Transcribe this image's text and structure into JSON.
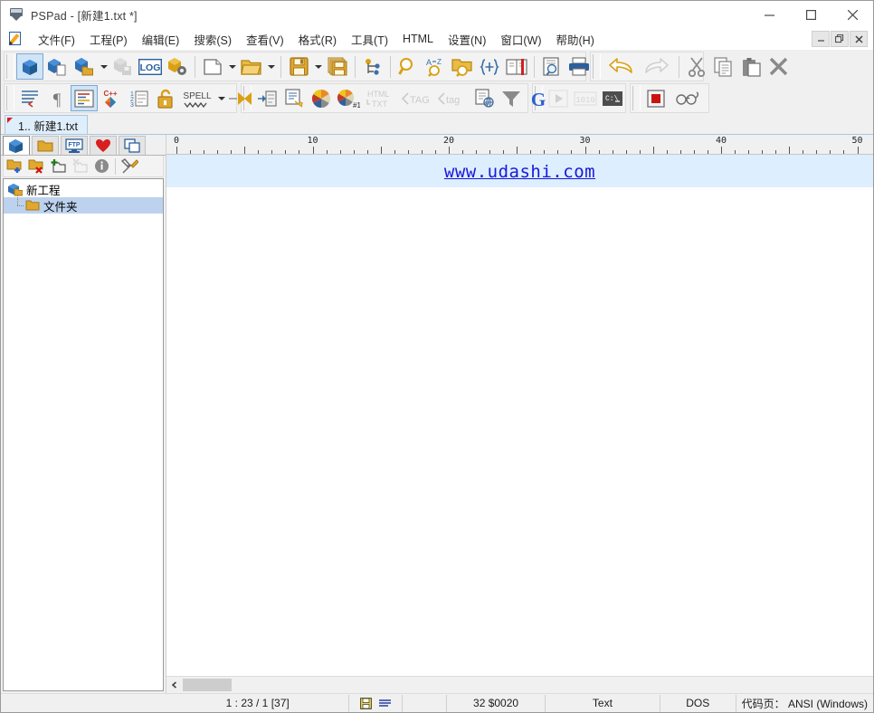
{
  "window": {
    "title": "PSPad - [新建1.txt *]",
    "app_icon": "pspad-monitor-icon",
    "controls": {
      "minimize": "minimize-icon",
      "maximize": "maximize-icon",
      "close": "close-icon"
    },
    "mdi_controls": {
      "minimize": "mdi-minimize-icon",
      "restore": "mdi-restore-icon",
      "close": "mdi-close-icon"
    }
  },
  "menubar": {
    "app_icon": "document-pencil-icon",
    "items": [
      {
        "text": "文件(F)",
        "accel": "F"
      },
      {
        "text": "工程(P)",
        "accel": "P"
      },
      {
        "text": "编辑(E)",
        "accel": "E"
      },
      {
        "text": "搜索(S)",
        "accel": "S"
      },
      {
        "text": "查看(V)",
        "accel": "V"
      },
      {
        "text": "格式(R)",
        "accel": "R"
      },
      {
        "text": "工具(T)",
        "accel": "T"
      },
      {
        "text": "HTML",
        "accel": "M"
      },
      {
        "text": "设置(N)",
        "accel": "N"
      },
      {
        "text": "窗口(W)",
        "accel": "W"
      },
      {
        "text": "帮助(H)",
        "accel": "H"
      }
    ]
  },
  "toolbar_row1": [
    {
      "name": "project-new-button",
      "icon": "blue-cube-icon",
      "state": "active"
    },
    {
      "name": "project-open-button",
      "icon": "cube-with-page-icon",
      "state": "normal"
    },
    {
      "name": "project-open-folder-button",
      "icon": "cube-with-folder-icon",
      "state": "normal"
    },
    {
      "name": "project-recent-dropdown",
      "icon": "chevron-down-icon",
      "state": "normal"
    },
    {
      "name": "project-save-button",
      "icon": "cube-save-icon",
      "state": "disabled"
    },
    {
      "name": "project-log-button",
      "icon": "log-icon",
      "state": "normal"
    },
    {
      "name": "project-settings-button",
      "icon": "cube-gear-icon",
      "state": "normal"
    },
    {
      "name": "file-new-button",
      "icon": "new-page-icon",
      "state": "normal"
    },
    {
      "name": "file-new-dropdown",
      "icon": "chevron-down-icon",
      "state": "normal"
    },
    {
      "name": "file-open-button",
      "icon": "open-folder-icon",
      "state": "normal"
    },
    {
      "name": "file-open-dropdown",
      "icon": "chevron-down-icon",
      "state": "normal"
    },
    {
      "name": "file-save-button",
      "icon": "floppy-save-icon",
      "state": "normal"
    },
    {
      "name": "file-save-dropdown",
      "icon": "chevron-down-icon",
      "state": "normal"
    },
    {
      "name": "file-save-all-button",
      "icon": "floppy-save-all-icon",
      "state": "normal"
    },
    {
      "name": "file-compare-button",
      "icon": "branch-compare-icon",
      "state": "normal"
    },
    {
      "name": "find-button",
      "icon": "magnifier-icon",
      "state": "normal"
    },
    {
      "name": "replace-button",
      "icon": "magnifier-replace-icon",
      "state": "normal"
    },
    {
      "name": "find-in-files-button",
      "icon": "folder-magnifier-icon",
      "state": "normal"
    },
    {
      "name": "regex-button",
      "icon": "curly-braces-icon",
      "state": "normal"
    },
    {
      "name": "bookmark-button",
      "icon": "book-bookmark-icon",
      "state": "normal"
    },
    {
      "name": "print-preview-button",
      "icon": "page-preview-icon",
      "state": "normal"
    },
    {
      "name": "print-button",
      "icon": "printer-icon",
      "state": "normal"
    },
    {
      "name": "undo-button",
      "icon": "undo-arrow-icon",
      "state": "normal"
    },
    {
      "name": "redo-button",
      "icon": "redo-arrow-icon",
      "state": "disabled"
    },
    {
      "name": "cut-button",
      "icon": "scissors-icon",
      "state": "normal"
    },
    {
      "name": "copy-button",
      "icon": "copy-pages-icon",
      "state": "normal"
    },
    {
      "name": "paste-button",
      "icon": "clipboard-paste-icon",
      "state": "normal"
    },
    {
      "name": "delete-button",
      "icon": "x-delete-icon",
      "state": "normal"
    }
  ],
  "toolbar_row2": [
    {
      "name": "word-wrap-button",
      "icon": "word-wrap-icon",
      "state": "normal"
    },
    {
      "name": "show-marks-button",
      "icon": "pilcrow-icon",
      "state": "normal"
    },
    {
      "name": "syntax-highlight-button",
      "icon": "highlight-lines-icon",
      "state": "active"
    },
    {
      "name": "syntax-mode-button",
      "icon": "cpp-colors-icon",
      "state": "normal"
    },
    {
      "name": "line-numbers-button",
      "icon": "numbered-list-icon",
      "state": "normal"
    },
    {
      "name": "readonly-lock-button",
      "icon": "padlock-icon",
      "state": "normal"
    },
    {
      "name": "spell-check-button",
      "icon": "spell-icon",
      "state": "normal"
    },
    {
      "name": "spell-check-dropdown",
      "icon": "chevron-down-icon",
      "state": "normal"
    },
    {
      "name": "pin-button",
      "icon": "pin-bowtie-icon",
      "state": "normal"
    },
    {
      "name": "indent-button",
      "icon": "indent-right-icon",
      "state": "normal"
    },
    {
      "name": "format-code-button",
      "icon": "format-document-icon",
      "state": "normal"
    },
    {
      "name": "color-picker-button",
      "icon": "color-wheel-icon",
      "state": "normal"
    },
    {
      "name": "color-palette-button",
      "icon": "color-wheel-216-icon",
      "state": "normal"
    },
    {
      "name": "html-to-text-button",
      "icon": "html-to-txt-icon",
      "state": "disabled"
    },
    {
      "name": "tag-upper-button",
      "icon": "tag-upper-icon",
      "state": "disabled"
    },
    {
      "name": "tag-lower-button",
      "icon": "tag-lower-icon",
      "state": "disabled"
    },
    {
      "name": "preview-web-button",
      "icon": "page-globe-icon",
      "state": "normal"
    },
    {
      "name": "filter-button",
      "icon": "funnel-icon",
      "state": "normal"
    },
    {
      "name": "google-search-button",
      "icon": "google-g-icon",
      "state": "normal"
    },
    {
      "name": "run-button",
      "icon": "play-triangle-icon",
      "state": "disabled"
    },
    {
      "name": "hex-view-button",
      "icon": "binary-1010-icon",
      "state": "disabled"
    },
    {
      "name": "console-button",
      "icon": "cmd-console-icon",
      "state": "normal"
    },
    {
      "name": "stop-button",
      "icon": "red-square-stop-icon",
      "state": "normal"
    },
    {
      "name": "reading-mode-button",
      "icon": "glasses-icon",
      "state": "normal"
    }
  ],
  "doc_tabs": [
    {
      "label": "1.. 新建1.txt",
      "modified": true
    }
  ],
  "left_panel": {
    "tabs": [
      {
        "name": "tab-project",
        "icon": "blue-cube-icon",
        "selected": true
      },
      {
        "name": "tab-explorer",
        "icon": "folder-icon",
        "selected": false
      },
      {
        "name": "tab-ftp",
        "icon": "ftp-monitor-icon",
        "selected": false
      },
      {
        "name": "tab-favorites",
        "icon": "heart-icon",
        "selected": false
      },
      {
        "name": "tab-windows",
        "icon": "windows-cascade-icon",
        "selected": false
      }
    ],
    "mini_toolbar": [
      {
        "name": "add-folder-button",
        "icon": "folder-plus-icon"
      },
      {
        "name": "remove-folder-button",
        "icon": "folder-x-icon"
      },
      {
        "name": "add-file-button",
        "icon": "file-plus-icon"
      },
      {
        "name": "remove-file-button",
        "icon": "file-x-icon",
        "state": "disabled"
      },
      {
        "name": "project-info-button",
        "icon": "info-circle-icon"
      },
      {
        "name": "project-tools-button",
        "icon": "hammer-wrench-icon"
      }
    ],
    "tree": {
      "root": {
        "label": "新工程",
        "icon": "project-cube-icon"
      },
      "children": [
        {
          "label": "文件夹",
          "icon": "folder-icon",
          "selected": true
        }
      ]
    }
  },
  "ruler": {
    "labels": [
      "0",
      "10",
      "20",
      "30",
      "40",
      "50"
    ],
    "major_step": 10,
    "minor_step": 5,
    "max": 50
  },
  "editor": {
    "lines": [
      {
        "text": "www.udashi.com",
        "current": true,
        "link": true
      }
    ]
  },
  "hscroll": {
    "left_arrow": "chevron-left-icon"
  },
  "statusbar": {
    "cursor": "1 : 23 / 1  [37]",
    "modified_icon": "floppy-modified-icon",
    "lines_icon": "lines-icon",
    "char_code": "32  $0020",
    "syntax": "Text",
    "line_ending": "DOS",
    "codepage": "代码页： ANSI (Windows)"
  },
  "colors": {
    "accent_blue": "#2b5f9e",
    "gold": "#d9a013",
    "link_blue": "#1818d8",
    "current_line": "#ddeeff",
    "tab_selected": "#dfeefb",
    "tree_selected": "#bcd2ee"
  }
}
